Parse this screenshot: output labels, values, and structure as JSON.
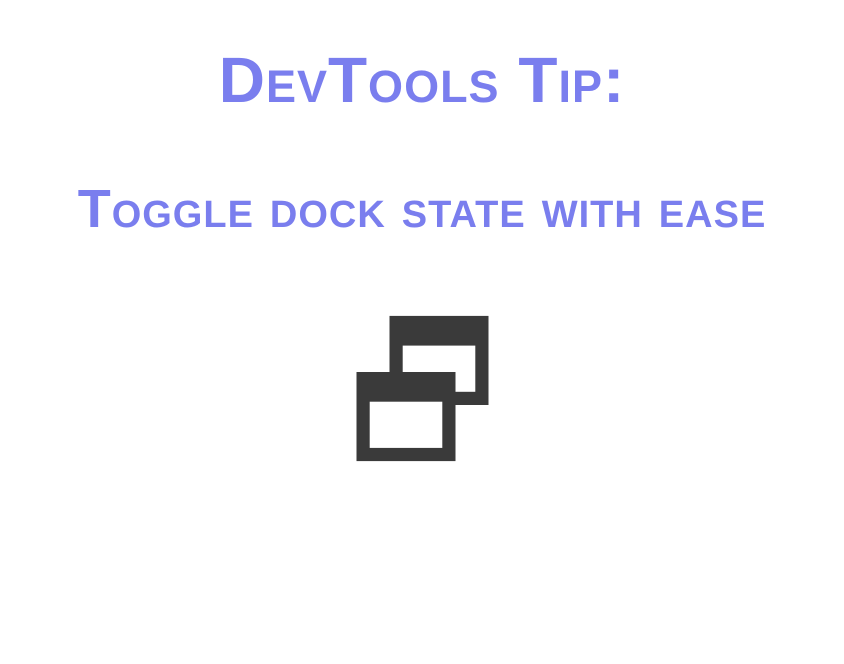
{
  "title": "DevTools Tip:",
  "subtitle": "Toggle dock state with ease",
  "colors": {
    "heading": "#7a7eee",
    "icon": "#3a3a3a"
  },
  "icon": "dock-undock-icon"
}
